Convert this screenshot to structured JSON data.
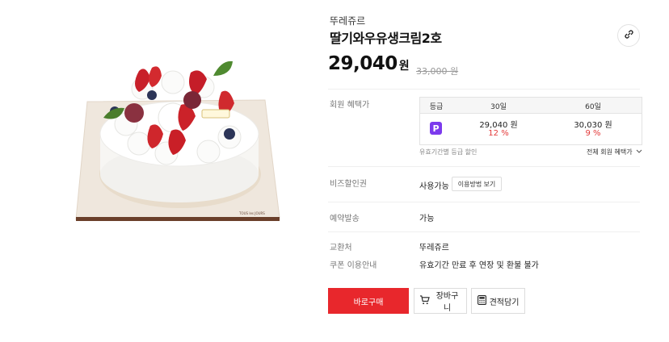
{
  "product": {
    "brand": "뚜레쥬르",
    "name": "딸기와우유생크림2호",
    "price": "29,040",
    "price_unit": "원",
    "original_price": "33,000 원",
    "image_alt": "딸기 생크림 케이크",
    "cake_plate_text": "TOUS les JOURS"
  },
  "member_benefit": {
    "label": "회원 혜택가",
    "headers": [
      "등급",
      "30일",
      "60일"
    ],
    "grade_badge": "P",
    "cols": [
      {
        "price": "29,040 원",
        "discount": "12 %"
      },
      {
        "price": "30,030 원",
        "discount": "9 %"
      }
    ],
    "note": "유효기간별 등급 할인",
    "all_benefits": "전체 회원 혜택가"
  },
  "biz": {
    "label": "비즈할인권",
    "value": "사용가능",
    "button": "이용방법 보기"
  },
  "reservation": {
    "label": "예약발송",
    "value": "가능"
  },
  "exchange": {
    "label": "교환처",
    "value": "뚜레쥬르"
  },
  "coupon": {
    "label": "쿠폰 이용안내",
    "value": "유효기간 만료 후 연장 및 환불 불가"
  },
  "actions": {
    "buy": "바로구매",
    "cart": "장바구니",
    "quote": "견적담기"
  },
  "colors": {
    "accent": "#e8272c",
    "discount": "#e33a3a",
    "badge": "#7c3aed"
  }
}
